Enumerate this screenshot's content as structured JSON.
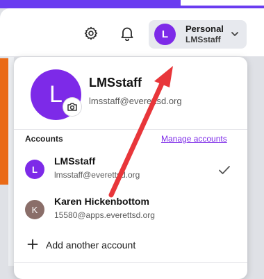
{
  "header": {
    "profile_title": "Personal",
    "profile_subtitle": "LMSstaff",
    "avatar_initial": "L",
    "icons": [
      "gear-icon",
      "bell-icon",
      "chevron-down-icon"
    ]
  },
  "dropdown": {
    "current_user": {
      "initial": "L",
      "name": "LMSstaff",
      "email": "lmsstaff@everettsd.org"
    },
    "accounts_heading": "Accounts",
    "manage_link": "Manage accounts",
    "accounts": [
      {
        "initial": "L",
        "name": "LMSstaff",
        "email": "lmsstaff@everettsd.org",
        "selected": true
      },
      {
        "initial": "K",
        "name": "Karen Hickenbottom",
        "email": "15580@apps.everettsd.org",
        "selected": false
      }
    ],
    "add_account_label": "Add another account"
  },
  "colors": {
    "brand_purple": "#7d2ae8",
    "top_band": "#6a3cf0",
    "accent_orange": "#ea6a16",
    "annotation_arrow": "#e8363a",
    "second_avatar": "#8a6e69"
  }
}
